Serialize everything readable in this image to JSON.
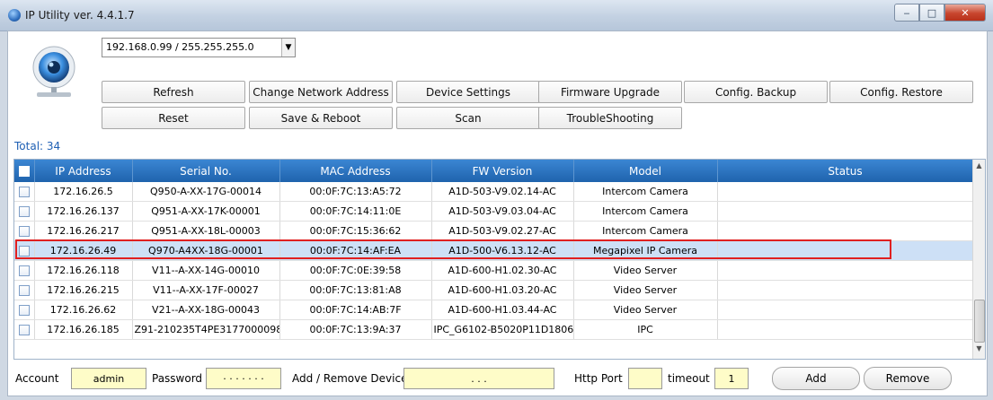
{
  "window": {
    "title": "IP Utility ver. 4.4.1.7",
    "min": "‒",
    "max": "□",
    "close": "✕"
  },
  "toolbar": {
    "network_select": "192.168.0.99 / 255.255.255.0",
    "buttons": {
      "refresh": "Refresh",
      "change_network": "Change Network Address",
      "device_settings": "Device Settings",
      "firmware_upgrade": "Firmware Upgrade",
      "config_backup": "Config. Backup",
      "config_restore": "Config. Restore",
      "reset": "Reset",
      "save_reboot": "Save & Reboot",
      "scan": "Scan",
      "troubleshooting": "TroubleShooting"
    }
  },
  "total": "Total: 34",
  "table": {
    "headers": [
      "IP Address",
      "Serial No.",
      "MAC Address",
      "FW Version",
      "Model",
      "Status"
    ],
    "rows": [
      [
        "172.16.26.5",
        "Q950-A-XX-17G-00014",
        "00:0F:7C:13:A5:72",
        "A1D-503-V9.02.14-AC",
        "Intercom Camera",
        ""
      ],
      [
        "172.16.26.137",
        "Q951-A-XX-17K-00001",
        "00:0F:7C:14:11:0E",
        "A1D-503-V9.03.04-AC",
        "Intercom Camera",
        ""
      ],
      [
        "172.16.26.217",
        "Q951-A-XX-18L-00003",
        "00:0F:7C:15:36:62",
        "A1D-503-V9.02.27-AC",
        "Intercom Camera",
        ""
      ],
      [
        "172.16.26.49",
        "Q970-A4XX-18G-00001",
        "00:0F:7C:14:AF:EA",
        "A1D-500-V6.13.12-AC",
        "Megapixel IP Camera",
        ""
      ],
      [
        "172.16.26.118",
        "V11--A-XX-14G-00010",
        "00:0F:7C:0E:39:58",
        "A1D-600-H1.02.30-AC",
        "Video Server",
        ""
      ],
      [
        "172.16.26.215",
        "V11--A-XX-17F-00027",
        "00:0F:7C:13:81:A8",
        "A1D-600-H1.03.20-AC",
        "Video Server",
        ""
      ],
      [
        "172.16.26.62",
        "V21--A-XX-18G-00043",
        "00:0F:7C:14:AB:7F",
        "A1D-600-H1.03.44-AC",
        "Video Server",
        ""
      ],
      [
        "172.16.26.185",
        "Z91-210235T4PE3177000098",
        "00:0F:7C:13:9A:37",
        "IPC_G6102-B5020P11D1806...",
        "IPC",
        ""
      ]
    ],
    "selected_row_index": 3
  },
  "bottom": {
    "account_label": "Account",
    "account_value": "admin",
    "password_label": "Password",
    "password_value": "· · · · · · ·",
    "add_remove_label": "Add / Remove Device",
    "ip_dots": ".          .          .",
    "http_port_label": "Http Port",
    "http_port_value": "",
    "timeout_label": "timeout",
    "timeout_value": "1",
    "add": "Add",
    "remove": "Remove"
  },
  "colors": {
    "header": "#2a74c2",
    "selection": "#cde0f6",
    "highlight_box": "#e02020",
    "input_bg": "#fefcc8",
    "total_text": "#1e5fb4"
  }
}
